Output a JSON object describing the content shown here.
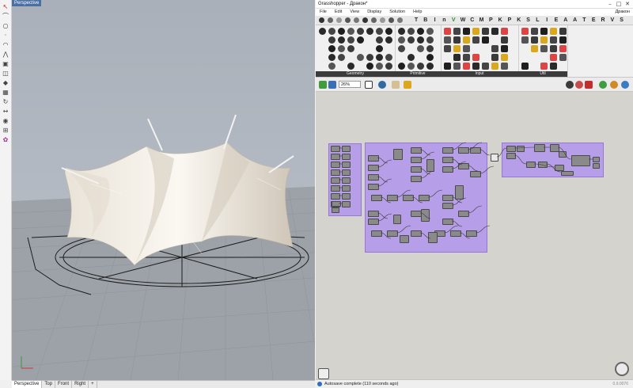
{
  "rhino": {
    "viewport_title": "Perspective",
    "viewport_tabs": [
      "Perspective",
      "Top",
      "Front",
      "Right"
    ],
    "add_tab": "+",
    "axis_x": "x",
    "axis_y": "y",
    "left_tools": [
      "select-icon",
      "curve-icon",
      "circle-icon",
      "point-icon",
      "arc-icon",
      "polyline-icon",
      "box-icon",
      "surface-icon",
      "solid-icon",
      "mesh-icon",
      "transform-icon",
      "dimension-icon",
      "render-icon",
      "analyze-icon",
      "plugin-icon"
    ],
    "colors": {
      "sky_top": "#aab0b9",
      "ground": "#9ea3a9",
      "tent": "#efe9df",
      "mast": "#e0e0e0"
    }
  },
  "grasshopper": {
    "window_title": "Grasshopper - Дракон*",
    "window_controls": [
      "–",
      "□",
      "✕"
    ],
    "menu": [
      "File",
      "Edit",
      "View",
      "Display",
      "Solution",
      "Help"
    ],
    "menu_right": "Дракон",
    "category_tabs": [
      "T",
      "B",
      "I",
      "n",
      "V",
      "W",
      "C",
      "M",
      "P",
      "K",
      "P",
      "K",
      "S",
      "L",
      "I",
      "E",
      "A",
      "A",
      "T",
      "E",
      "R",
      "V",
      "S"
    ],
    "selected_category_index": 4,
    "ribbon_panels": [
      "Geometry",
      "Primitive",
      "Input",
      "Util"
    ],
    "zoom": "26%",
    "status": "Autosave complete (110 seconds ago)",
    "version": "0.9.0076",
    "colors": {
      "group": "#b79ee9",
      "canvas": "#d5d3cd",
      "component": "#8a8a8a"
    }
  }
}
